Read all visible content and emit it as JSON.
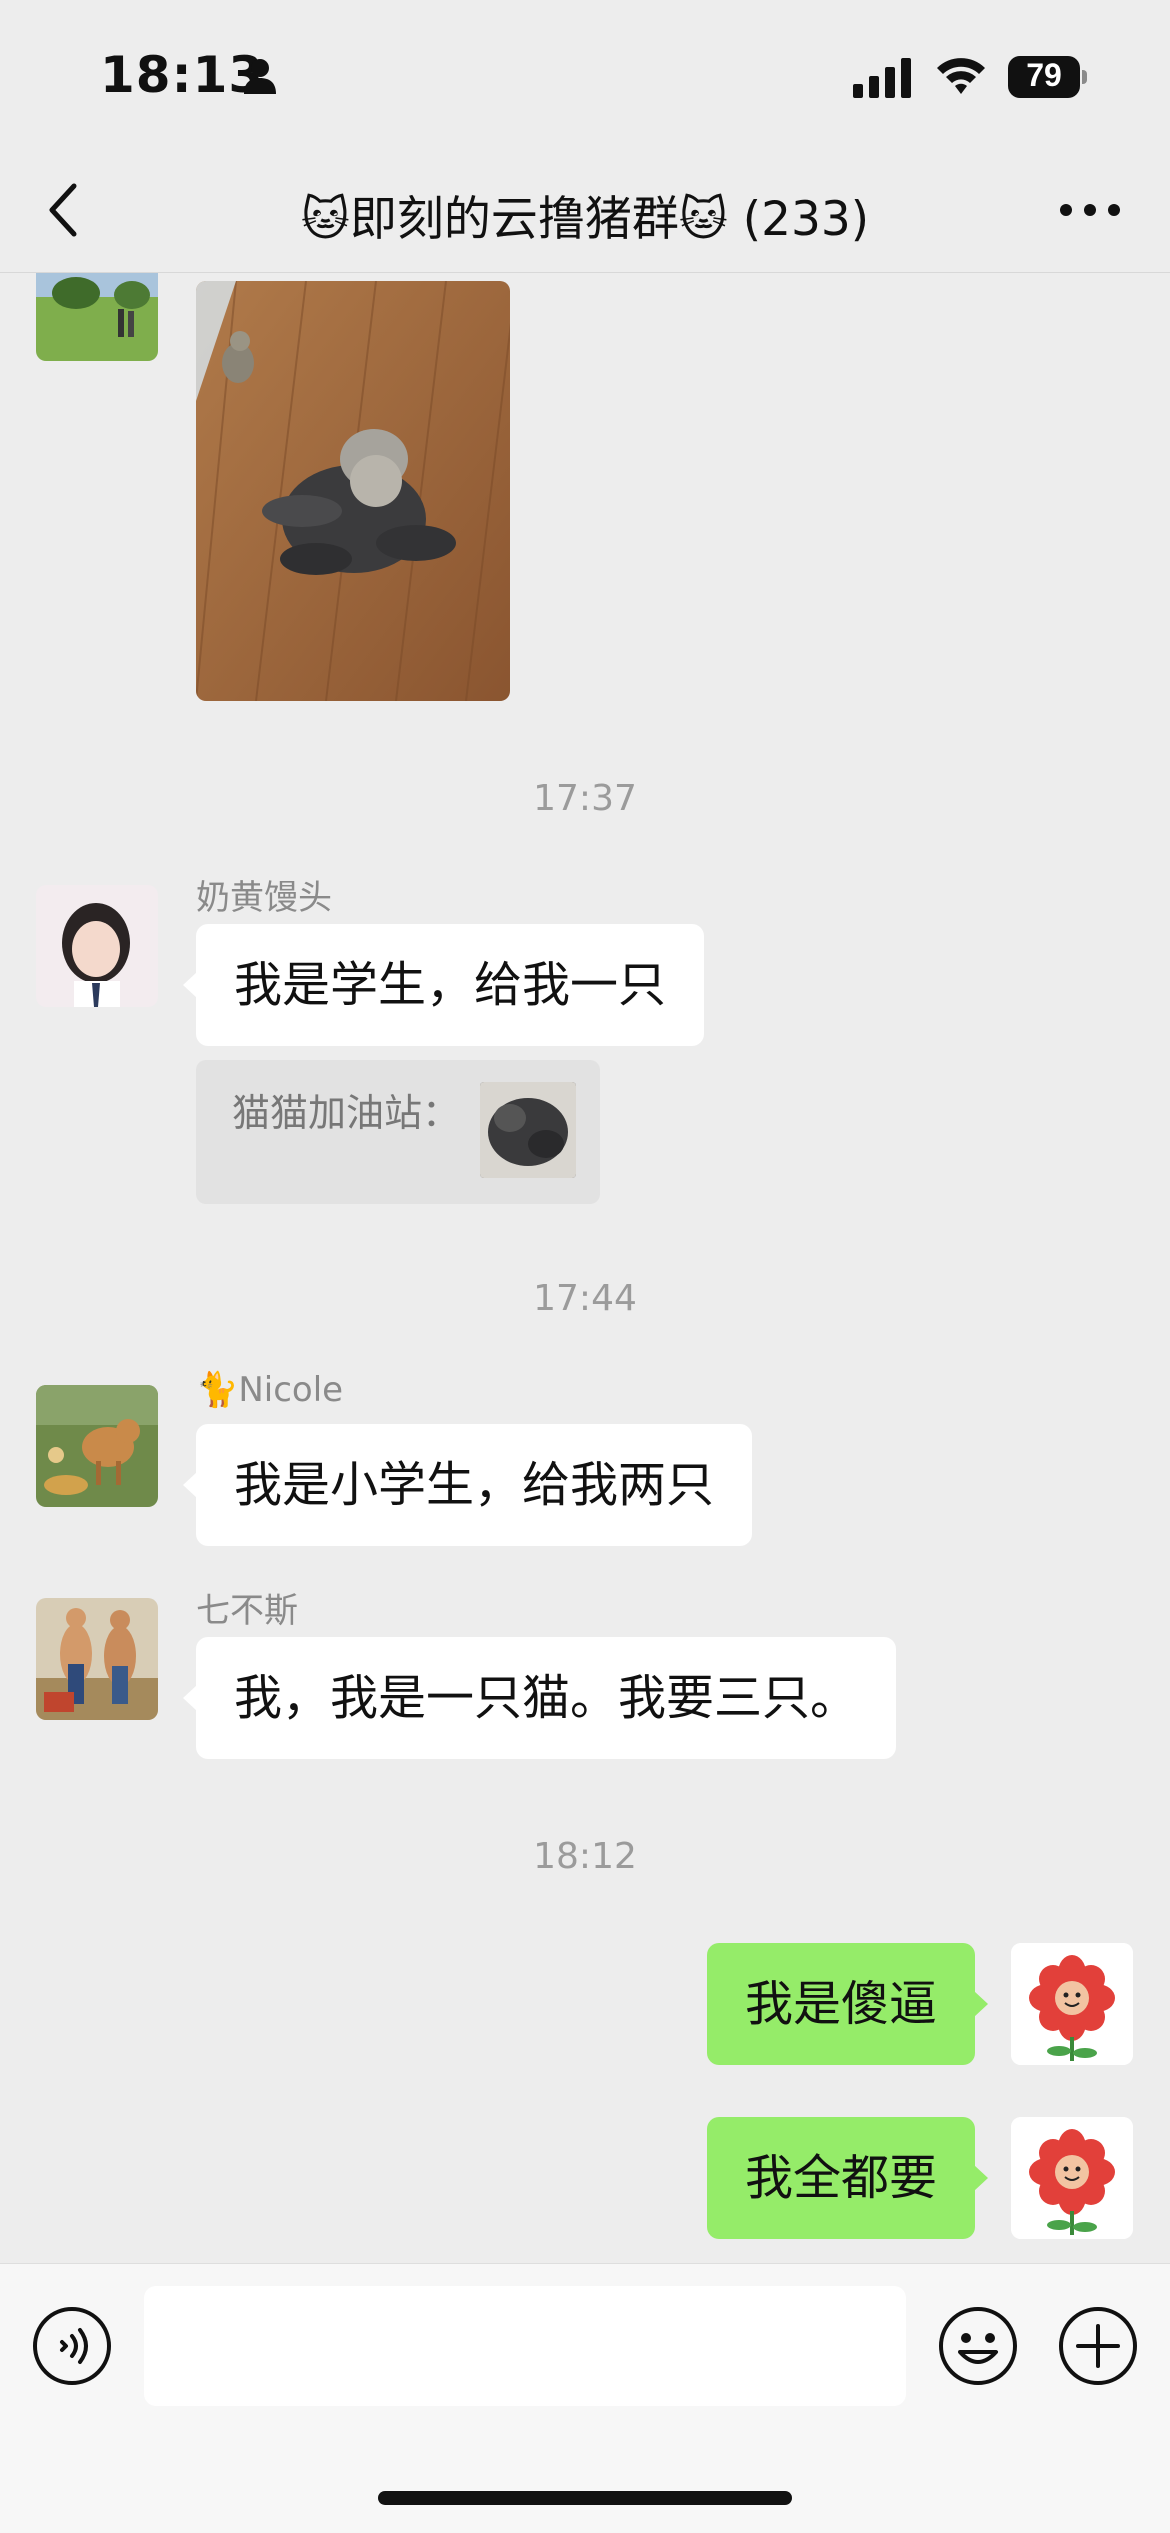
{
  "status_bar": {
    "time": "18:13",
    "battery": "79"
  },
  "nav": {
    "title": "🐱即刻的云撸猪群🐱 (233)"
  },
  "messages": [
    {
      "type": "image",
      "desc": "cats-on-wood-floor"
    },
    {
      "type": "time",
      "text": "17:37"
    },
    {
      "type": "text",
      "sender": "奶黄馒头",
      "text": "我是学生，给我一只"
    },
    {
      "type": "quote",
      "text": "猫猫加油站："
    },
    {
      "type": "time",
      "text": "17:44"
    },
    {
      "type": "text",
      "sender": "🐈Nicole",
      "text": "我是小学生，给我两只"
    },
    {
      "type": "text",
      "sender": "七不斯",
      "text": "我，我是一只猫。我要三只。"
    },
    {
      "type": "time",
      "text": "18:12"
    },
    {
      "type": "text_self",
      "text": "我是傻逼"
    },
    {
      "type": "text_self",
      "text": "我全都要"
    }
  ],
  "icons": {
    "back": "chevron-left-icon",
    "more": "ellipsis-icon",
    "voice": "voice-icon",
    "emoji": "smiley-icon",
    "plus": "plus-icon"
  },
  "colors": {
    "background": "#ededed",
    "self_bubble": "#95ec69",
    "other_bubble": "#ffffff"
  }
}
